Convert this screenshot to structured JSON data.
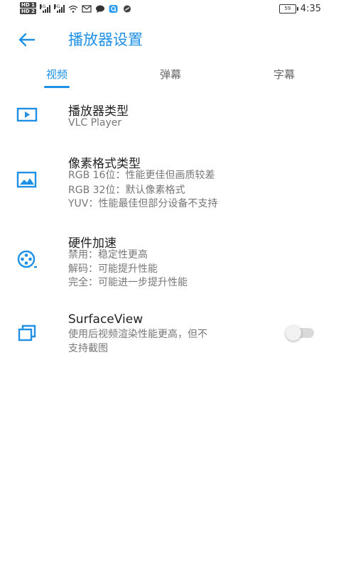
{
  "status_bar": {
    "sim1": "HD 1",
    "sim2": "HD 2",
    "net1": "4G",
    "net2": "4G",
    "battery": "59",
    "time": "4:35"
  },
  "app_bar": {
    "title": "播放器设置"
  },
  "tabs": [
    {
      "label": "视频",
      "active": true
    },
    {
      "label": "弹幕",
      "active": false
    },
    {
      "label": "字幕",
      "active": false
    }
  ],
  "settings": [
    {
      "title": "播放器类型",
      "icon": "play-icon",
      "lines": [
        "VLC Player"
      ]
    },
    {
      "title": "像素格式类型",
      "icon": "image-icon",
      "lines": [
        "RGB 16位：性能更佳但画质较差",
        "RGB 32位：默认像素格式",
        "YUV：性能最佳但部分设备不支持"
      ]
    },
    {
      "title": "硬件加速",
      "icon": "film-reel-icon",
      "lines": [
        "禁用：稳定性更高",
        "解码：可能提升性能",
        "完全：可能进一步提升性能"
      ]
    },
    {
      "title": "SurfaceView",
      "icon": "layers-icon",
      "lines": [
        "使用后视频渲染性能更高，但不",
        "支持截图"
      ],
      "toggle_on": false
    }
  ],
  "colors": {
    "accent": "#1e90e6"
  }
}
